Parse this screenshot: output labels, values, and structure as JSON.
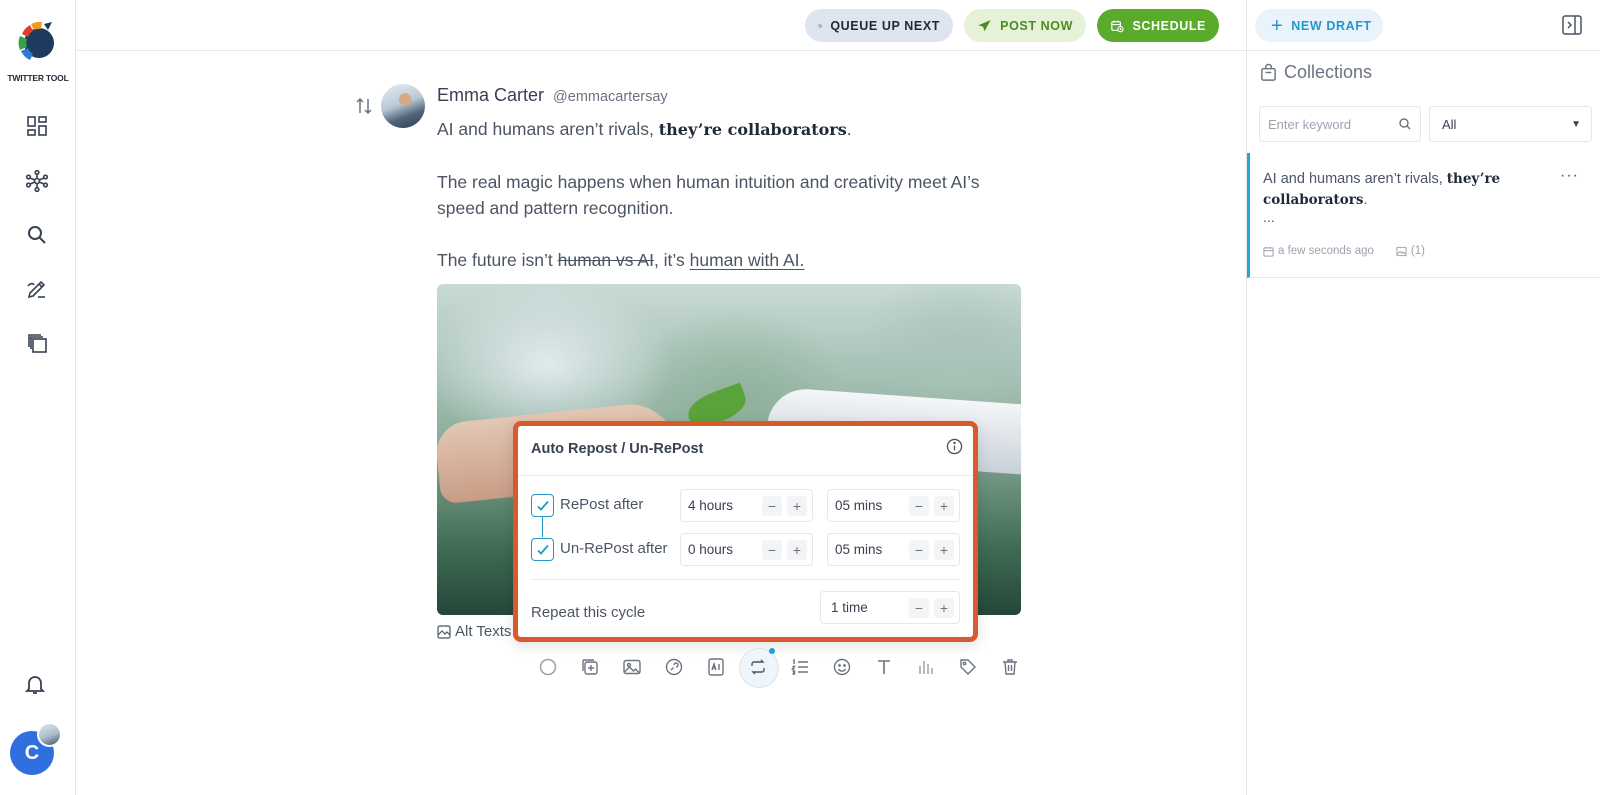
{
  "app": {
    "logo_text": "TWITTER TOOL",
    "user_initial": "C"
  },
  "topbar": {
    "queue_label": "QUEUE UP NEXT",
    "post_now_label": "POST NOW",
    "schedule_label": "SCHEDULE"
  },
  "right_panel": {
    "new_draft_label": "NEW DRAFT",
    "collections_title": "Collections",
    "search_placeholder": "Enter keyword",
    "filter_value": "All",
    "draft": {
      "text_start": "AI and humans aren’t rivals, ",
      "text_bold": "they’re collaborators",
      "text_end": ".",
      "ellipsis": "...",
      "time": "a few seconds ago",
      "image_count": "(1)"
    }
  },
  "post": {
    "author_name": "Emma Carter",
    "author_handle": "@emmacartersay",
    "line1_start": "AI and humans aren’t rivals, ",
    "line1_bold": "they’re collaborators",
    "line1_end": ".",
    "paragraph2": "The real magic happens when human intuition and creativity meet AI’s speed and pattern recognition.",
    "line3_start": "The future isn’t ",
    "line3_strike": "human vs AI",
    "line3_mid": ", it’s ",
    "line3_underline": "human with AI. ",
    "alt_texts_label": "Alt Texts"
  },
  "popup": {
    "title": "Auto Repost / Un-RePost",
    "repost_label": "RePost after",
    "repost_hours": "4 hours",
    "repost_mins": "05 mins",
    "unrepost_label": "Un-RePost after",
    "unrepost_hours": "0 hours",
    "unrepost_mins": "05 mins",
    "repeat_label": "Repeat this cycle",
    "repeat_value": "1 time",
    "minus": "−",
    "plus": "+",
    "repost_checked": true,
    "unrepost_checked": true
  },
  "colors": {
    "accent": "#2596c8",
    "popup_border": "#d85a2b",
    "schedule_green": "#5aab2c",
    "post_now_text": "#4d8a1f"
  }
}
